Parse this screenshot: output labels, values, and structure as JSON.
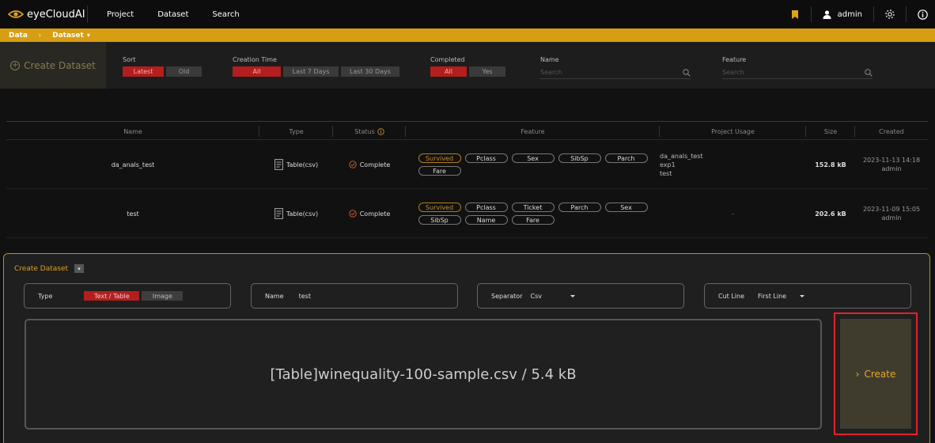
{
  "app": {
    "name": "eyeCloudAI"
  },
  "nav": {
    "items": [
      "Project",
      "Dataset",
      "Search"
    ],
    "user": "admin"
  },
  "breadcrumb": {
    "root": "Data",
    "current": "Dataset"
  },
  "filters": {
    "create_button": "Create Dataset",
    "sort": {
      "label": "Sort",
      "options": [
        "Latest",
        "Old"
      ],
      "selected": "Latest"
    },
    "creation_time": {
      "label": "Creation Time",
      "options": [
        "All",
        "Last 7 Days",
        "Last 30 Days"
      ],
      "selected": "All"
    },
    "completed": {
      "label": "Completed",
      "options": [
        "All",
        "Yes"
      ],
      "selected": "All"
    },
    "name": {
      "label": "Name",
      "placeholder": "Search"
    },
    "feature": {
      "label": "Feature",
      "placeholder": "Search"
    }
  },
  "table": {
    "columns": [
      "Name",
      "Type",
      "Status",
      "Feature",
      "Project Usage",
      "Size",
      "Created"
    ],
    "rows": [
      {
        "name": "da_anals_test",
        "type": "Table(csv)",
        "status": "Complete",
        "features": [
          "Survived",
          "Pclass",
          "Sex",
          "SibSp",
          "Parch",
          "Fare"
        ],
        "usage": [
          "da_anals_test",
          "exp1",
          "test"
        ],
        "size": "152.8 kB",
        "created_date": "2023-11-13 14:18",
        "created_by": "admin"
      },
      {
        "name": "test",
        "type": "Table(csv)",
        "status": "Complete",
        "features": [
          "Survived",
          "Pclass",
          "Ticket",
          "Parch",
          "Sex",
          "SibSp",
          "Name",
          "Fare"
        ],
        "usage_empty": "-",
        "size": "202.6 kB",
        "created_date": "2023-11-09 15:05",
        "created_by": "admin"
      }
    ]
  },
  "create_panel": {
    "title": "Create Dataset",
    "type_label": "Type",
    "type_options": [
      "Text / Table",
      "Image"
    ],
    "type_selected": "Text / Table",
    "name_label": "Name",
    "name_value": "test",
    "separator_label": "Separator",
    "separator_value": "Csv",
    "cutline_label": "Cut Line",
    "cutline_value": "First Line",
    "file_display": "[Table]winequality-100-sample.csv / 5.4 kB",
    "create_button": "Create"
  },
  "colors": {
    "accent": "#d79d13",
    "active": "#b41e1e",
    "highlight": "#e4202a"
  }
}
